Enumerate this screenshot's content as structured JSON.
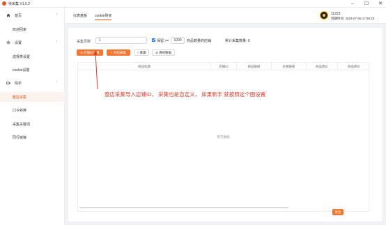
{
  "window": {
    "title": "快采集  V1.0.2",
    "controls": [
      "–",
      "☐",
      "✕"
    ]
  },
  "sidebar": {
    "items": [
      {
        "label": "首页",
        "icon": "home-icon",
        "chevron": "⌃"
      },
      {
        "label": "欢迎回家"
      },
      {
        "label": "设置",
        "icon": "gear-icon",
        "chevron": "⌃"
      },
      {
        "label": "选择类设置"
      },
      {
        "label": "cookie设置"
      },
      {
        "label": "快手",
        "icon": "kuaishou-icon",
        "chevron": "⌃"
      },
      {
        "label": "整店采集"
      },
      {
        "label": "口令转换"
      },
      {
        "label": "采集关键词"
      },
      {
        "label": "同行链接"
      }
    ]
  },
  "header": {
    "tabs": [
      {
        "label": "仪表盘板"
      },
      {
        "label": "cookie购买"
      }
    ],
    "user_id": "11223",
    "expiry": "到期时间: 2024-07-05 17:58:23"
  },
  "form": {
    "pages_label": "采集页数",
    "pages_value": "1",
    "sold_check_label": "保留 >=",
    "sold_value": "1000",
    "sold_suffix": "商品数量的店铺",
    "count_label": "累计采集数量: 0"
  },
  "buttons": {
    "shop_id": "⊕ 店铺ID设置",
    "start": "+ 开始采集",
    "reset": "○ 重置",
    "clear": "⊘ 清除数据",
    "export": "导出"
  },
  "table": {
    "columns": [
      "商品标题",
      "店铺ID",
      "商品链接",
      "主图链接",
      "商品售价",
      "商品原价"
    ],
    "empty_text": "暂无数据"
  },
  "annotation": {
    "text": "整店采集导入店铺ID， 采集也是自定义， 如果新手 就按照这个图设置"
  },
  "colors": {
    "accent": "#f5762e",
    "annotation": "#e33b2e",
    "checkbox": "#1677ff"
  }
}
